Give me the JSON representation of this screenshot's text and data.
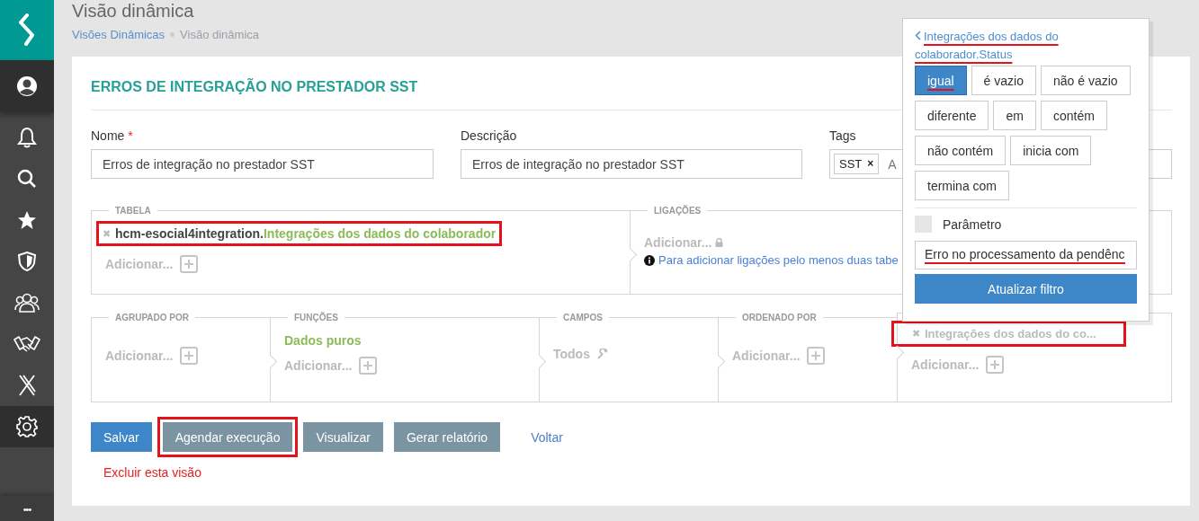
{
  "sidebar": {
    "items": [
      {
        "kind": "user",
        "selected": true
      },
      {
        "kind": "bell",
        "selected": false
      },
      {
        "kind": "search",
        "selected": false
      },
      {
        "kind": "star",
        "selected": false
      },
      {
        "kind": "shield",
        "selected": false
      },
      {
        "kind": "group",
        "selected": false
      },
      {
        "kind": "handshake",
        "selected": false
      },
      {
        "kind": "cross",
        "selected": false
      },
      {
        "kind": "gear",
        "selected": true
      }
    ],
    "more": "•••"
  },
  "page": {
    "title": "Visão dinâmica",
    "breadcrumb": [
      {
        "label": "Visões Dinâmicas",
        "link": true
      },
      {
        "label": "Visão dinâmica",
        "link": false
      }
    ]
  },
  "card": {
    "title": "ERROS DE INTEGRAÇÃO NO PRESTADOR SST",
    "name": {
      "label": "Nome",
      "required_mark": "*",
      "value": "Erros de integração no prestador SST"
    },
    "description": {
      "label": "Descrição",
      "value": "Erros de integração no prestador SST"
    },
    "tags": {
      "label": "Tags",
      "tags": [
        {
          "label": "SST",
          "remove": "×"
        }
      ],
      "placeholder": "A"
    },
    "tabela": {
      "label": "TABELA",
      "remove": "✖",
      "prefix": "hcm-esocial4integration.",
      "name": "Integrações dos dados do colaborador",
      "highlighted": true,
      "add": "Adicionar..."
    },
    "ligacoes": {
      "label": "LIGAÇÕES",
      "add": "Adicionar...",
      "info": "Para adicionar ligações pelo menos duas tabe"
    },
    "sections": [
      {
        "kind": "add",
        "label": "AGRUPADO POR",
        "add": "Adicionar..."
      },
      {
        "kind": "functions",
        "label": "FUNÇÕES",
        "value": "Dados puros",
        "add": "Adicionar..."
      },
      {
        "kind": "fields",
        "label": "CAMPOS",
        "value": "Todos"
      },
      {
        "kind": "add",
        "label": "ORDENADO POR",
        "add": "Adicionar..."
      },
      {
        "kind": "filters",
        "remove": "✖",
        "filter": "Integrações dos dados do co...",
        "highlighted": true,
        "add": "Adicionar..."
      }
    ],
    "buttons": [
      {
        "label": "Salvar",
        "kind": "primary",
        "highlighted": false
      },
      {
        "label": "Agendar execução",
        "kind": "secondary",
        "highlighted": true
      },
      {
        "label": "Visualizar",
        "kind": "secondary",
        "highlighted": false
      },
      {
        "label": "Gerar relatório",
        "kind": "secondary",
        "highlighted": false
      },
      {
        "label": "Voltar",
        "kind": "link",
        "highlighted": false
      }
    ],
    "delete": "Excluir esta visão"
  },
  "popup": {
    "back": "Integrações dos dados do colaborador.Status",
    "back_underlined": true,
    "operators": [
      {
        "label": "igual",
        "selected": true,
        "underlined": true
      },
      {
        "label": "é vazio",
        "selected": false,
        "underlined": false
      },
      {
        "label": "não é vazio",
        "selected": false,
        "underlined": false
      },
      {
        "label": "diferente",
        "selected": false,
        "underlined": false
      },
      {
        "label": "em",
        "selected": false,
        "underlined": false
      },
      {
        "label": "contém",
        "selected": false,
        "underlined": false
      },
      {
        "label": "não contém",
        "selected": false,
        "underlined": false
      },
      {
        "label": "inicia com",
        "selected": false,
        "underlined": false
      },
      {
        "label": "termina com",
        "selected": false,
        "underlined": false
      }
    ],
    "parameter": {
      "label": "Parâmetro",
      "checked": false
    },
    "value": "Erro no processamento da pendênc",
    "value_underlined": true,
    "submit": "Atualizar filtro"
  }
}
